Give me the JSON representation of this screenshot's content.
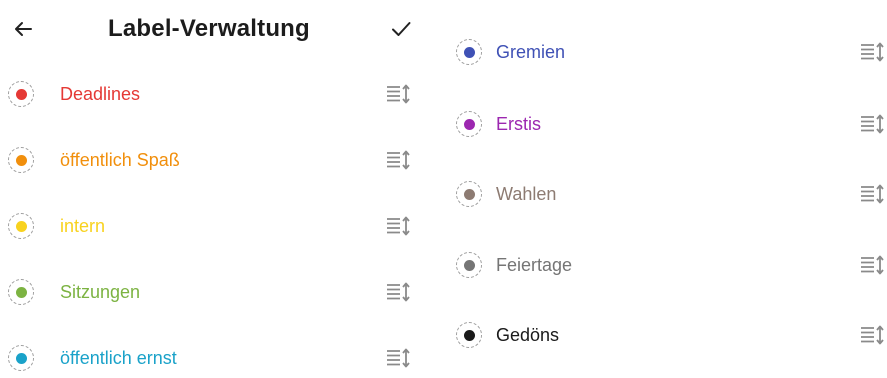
{
  "header": {
    "title": "Label-Verwaltung",
    "back_icon": "arrow-left-icon",
    "confirm_icon": "check-icon"
  },
  "left_labels": [
    {
      "name": "Deadlines",
      "color": "#e53935"
    },
    {
      "name": "öffentlich Spaß",
      "color": "#f18f0c"
    },
    {
      "name": "intern",
      "color": "#f8d21f"
    },
    {
      "name": "Sitzungen",
      "color": "#7cb342"
    },
    {
      "name": "öffentlich ernst",
      "color": "#1aa2c9"
    }
  ],
  "right_labels": [
    {
      "name": "Gremien",
      "color": "#3f51b5"
    },
    {
      "name": "Erstis",
      "color": "#9c27b0"
    },
    {
      "name": "Wahlen",
      "color": "#8d7b72"
    },
    {
      "name": "Feiertage",
      "color": "#757575"
    },
    {
      "name": "Gedöns",
      "color": "#1a1a1a"
    }
  ],
  "reorder_icon": "reorder-handle-icon"
}
